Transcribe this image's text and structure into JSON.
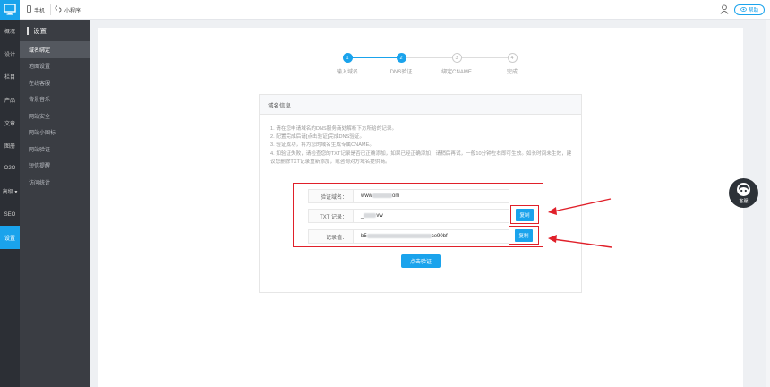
{
  "topbar": {
    "device_mobile": "手机",
    "device_miniapp": "小程序",
    "help_label": "帮助"
  },
  "nav": {
    "items": [
      "概况",
      "设计",
      "栏目",
      "产品",
      "文章",
      "图册",
      "O2O",
      "高级 ▾",
      "SEO",
      "设置"
    ],
    "active_index": 9
  },
  "subnav": {
    "title": "设置",
    "items": [
      "域名绑定",
      "地图设置",
      "在线客服",
      "背景音乐",
      "网站安全",
      "网站小图标",
      "网站验证",
      "短信提醒",
      "访问统计"
    ],
    "active_index": 0
  },
  "steps": {
    "items": [
      {
        "num": "1",
        "label": "输入域名",
        "state": "done"
      },
      {
        "num": "2",
        "label": "DNS验证",
        "state": "done"
      },
      {
        "num": "3",
        "label": "绑定CNAME",
        "state": "todo"
      },
      {
        "num": "4",
        "label": "完成",
        "state": "todo"
      }
    ]
  },
  "panel": {
    "title": "域名信息",
    "notes": [
      "1. 请在您申请域名的DNS服务商处解析下方所给的记录。",
      "2. 配置完成后请[点击验证]完成DNS验证。",
      "3. 验证成功，将为您的域名生成专属CNAME。",
      "4. 如验证失败，请检查您的TXT记录是否已正确添加，如果已经正确添加，请稍后再试，一般10分钟左右即可生效。如长时间未生效，建议您删除TXT记录重新添加，或咨询对方域名提供商。"
    ],
    "rows": [
      {
        "label": "验证域名：",
        "value_prefix": "www",
        "value_suffix": "om"
      },
      {
        "label": "TXT 记录：",
        "value_prefix": "_",
        "value_suffix": "vw"
      },
      {
        "label": "记录值：",
        "value_prefix": "b5",
        "value_suffix": "ce90bf"
      }
    ],
    "copy_label": "复制",
    "verify_label": "点击验证"
  },
  "service": {
    "label": "客服"
  },
  "colors": {
    "accent": "#1aa3ec",
    "highlight": "#e0202a",
    "nav_bg": "#2c2f35"
  }
}
